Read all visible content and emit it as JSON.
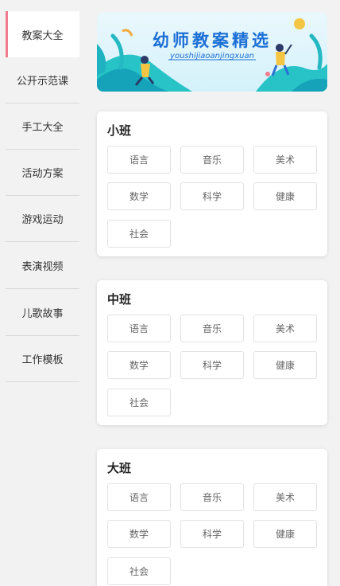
{
  "sidebar": {
    "items": [
      {
        "label": "教案大全",
        "active": true
      },
      {
        "label": "公开示范课"
      },
      {
        "label": "手工大全"
      },
      {
        "label": "活动方案"
      },
      {
        "label": "游戏运动"
      },
      {
        "label": "表演视频"
      },
      {
        "label": "儿歌故事"
      },
      {
        "label": "工作模板"
      }
    ]
  },
  "banner": {
    "title": "幼师教案精选",
    "subtitle": "youshijiaoanjingxuan"
  },
  "sections": [
    {
      "title": "小班",
      "subjects": [
        "语言",
        "音乐",
        "美术",
        "数学",
        "科学",
        "健康",
        "社会"
      ]
    },
    {
      "title": "中班",
      "subjects": [
        "语言",
        "音乐",
        "美术",
        "数学",
        "科学",
        "健康",
        "社会"
      ]
    },
    {
      "title": "大班",
      "subjects": [
        "语言",
        "音乐",
        "美术",
        "数学",
        "科学",
        "健康",
        "社会"
      ]
    }
  ],
  "colors": {
    "accent": "#f07b8e",
    "banner_text": "#1b6fd6"
  }
}
